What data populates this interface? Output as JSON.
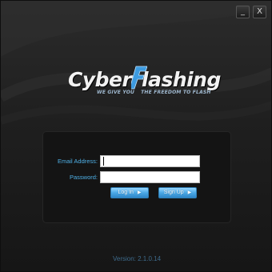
{
  "window": {
    "minimize_label": "_",
    "close_label": "X"
  },
  "logo": {
    "word1": "Cyber",
    "word2": "lashing",
    "tagline_left": "WE GIVE YOU",
    "tagline_right": "THE FREEDOM TO FLASH"
  },
  "form": {
    "email_label": "Email Address:",
    "email_value": "",
    "password_label": "Password:",
    "password_value": "",
    "login_label": "Log In",
    "signup_label": "Sign Up"
  },
  "footer": {
    "version": "Version: 2.1.0.14"
  },
  "colors": {
    "accent": "#4fb0e6",
    "button": "#4aa8e6",
    "background": "#1f1f1f"
  }
}
